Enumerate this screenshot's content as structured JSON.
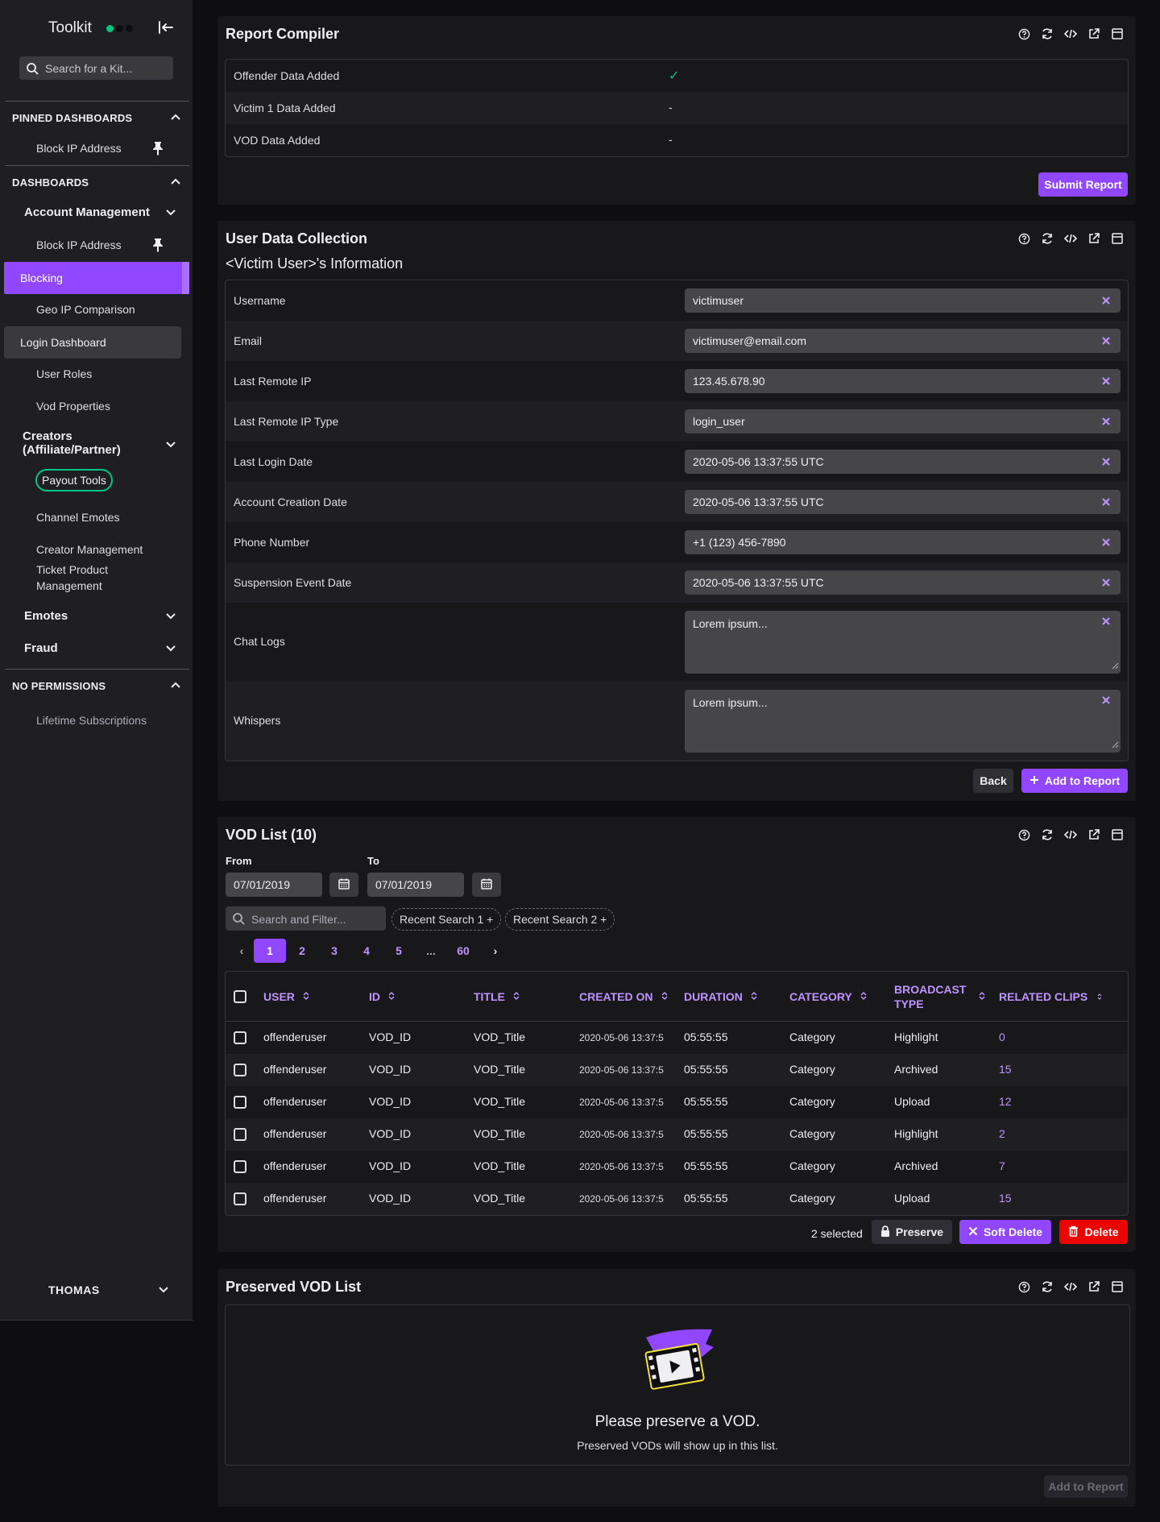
{
  "sidebar": {
    "title": "Toolkit",
    "search_placeholder": "Search for a Kit...",
    "pinned_header": "PINNED DASHBOARDS",
    "pinned_items": [
      "Block IP Address"
    ],
    "dashboards_header": "DASHBOARDS",
    "account_management": {
      "label": "Account Management",
      "items": [
        "Block IP Address",
        "Blocking",
        "Geo IP Comparison",
        "Login Dashboard",
        "User Roles",
        "Vod Properties"
      ]
    },
    "creators": {
      "label_line1": "Creators",
      "label_line2": "(Affiliate/Partner)",
      "items": [
        "Payout Tools",
        "Channel Emotes",
        "Creator Management",
        "Ticket Product",
        "Management"
      ]
    },
    "emotes_label": "Emotes",
    "fraud_label": "Fraud",
    "no_permissions_header": "NO PERMISSIONS",
    "no_permissions_items": [
      "Lifetime Subscriptions"
    ],
    "user_name": "THOMAS"
  },
  "report_compiler": {
    "title": "Report Compiler",
    "rows": [
      {
        "label": "Offender Data Added",
        "value": "✓"
      },
      {
        "label": "Victim 1 Data Added",
        "value": "-"
      },
      {
        "label": "VOD Data Added",
        "value": "-"
      }
    ],
    "submit_label": "Submit Report"
  },
  "user_data": {
    "title": "User Data Collection",
    "subtitle": "<Victim User>'s Information",
    "fields": [
      {
        "label": "Username",
        "value": "victimuser"
      },
      {
        "label": "Email",
        "value": "victimuser@email.com"
      },
      {
        "label": "Last Remote IP",
        "value": "123.45.678.90"
      },
      {
        "label": "Last Remote IP Type",
        "value": "login_user"
      },
      {
        "label": "Last Login Date",
        "value": "2020-05-06 13:37:55 UTC"
      },
      {
        "label": "Account Creation Date",
        "value": "2020-05-06 13:37:55 UTC"
      },
      {
        "label": "Phone Number",
        "value": "+1 (123) 456-7890"
      },
      {
        "label": "Suspension Event Date",
        "value": "2020-05-06 13:37:55 UTC"
      },
      {
        "label": "Chat Logs",
        "value": "Lorem ipsum..."
      },
      {
        "label": "Whispers",
        "value": "Lorem ipsum..."
      }
    ],
    "back_label": "Back",
    "add_label": "Add to Report"
  },
  "vod_list": {
    "title": "VOD List (10)",
    "from_label": "From",
    "to_label": "To",
    "from_value": "07/01/2019",
    "to_value": "07/01/2019",
    "filter_placeholder": "Search and Filter...",
    "recent_searches": [
      "Recent Search 1 +",
      "Recent Search 2 +"
    ],
    "pages": [
      "1",
      "2",
      "3",
      "4",
      "5",
      "...",
      "60"
    ],
    "current_page": "1",
    "columns": [
      "USER",
      "ID",
      "TITLE",
      "CREATED ON",
      "DURATION",
      "CATEGORY",
      "BROADCAST",
      "TYPE",
      "RELATED CLIPS"
    ],
    "rows": [
      {
        "user": "offenderuser",
        "id": "VOD_ID",
        "title": "VOD_Title",
        "created": "2020-05-06 13:37:5",
        "duration": "05:55:55",
        "category": "Category",
        "type": "Highlight",
        "clips": "0"
      },
      {
        "user": "offenderuser",
        "id": "VOD_ID",
        "title": "VOD_Title",
        "created": "2020-05-06 13:37:5",
        "duration": "05:55:55",
        "category": "Category",
        "type": "Archived",
        "clips": "15"
      },
      {
        "user": "offenderuser",
        "id": "VOD_ID",
        "title": "VOD_Title",
        "created": "2020-05-06 13:37:5",
        "duration": "05:55:55",
        "category": "Category",
        "type": "Upload",
        "clips": "12"
      },
      {
        "user": "offenderuser",
        "id": "VOD_ID",
        "title": "VOD_Title",
        "created": "2020-05-06 13:37:5",
        "duration": "05:55:55",
        "category": "Category",
        "type": "Highlight",
        "clips": "2"
      },
      {
        "user": "offenderuser",
        "id": "VOD_ID",
        "title": "VOD_Title",
        "created": "2020-05-06 13:37:5",
        "duration": "05:55:55",
        "category": "Category",
        "type": "Archived",
        "clips": "7"
      },
      {
        "user": "offenderuser",
        "id": "VOD_ID",
        "title": "VOD_Title",
        "created": "2020-05-06 13:37:5",
        "duration": "05:55:55",
        "category": "Category",
        "type": "Upload",
        "clips": "15"
      }
    ],
    "selected_text": "2 selected",
    "preserve_label": "Preserve",
    "soft_delete_label": "Soft Delete",
    "delete_label": "Delete"
  },
  "preserved": {
    "title": "Preserved VOD List",
    "empty_title": "Please preserve a VOD.",
    "empty_subtitle": "Preserved VODs will show up in this list.",
    "add_label": "Add to Report"
  },
  "icons": {
    "card_tools": [
      "help-icon",
      "refresh-icon",
      "code-icon",
      "popout-icon",
      "minimize-icon"
    ]
  },
  "colors": {
    "accent": "#9147ff",
    "accent_light": "#bf94ff",
    "success": "#00c77f",
    "danger": "#eb0400",
    "background": "#0e0e10",
    "card": "#18181b"
  }
}
